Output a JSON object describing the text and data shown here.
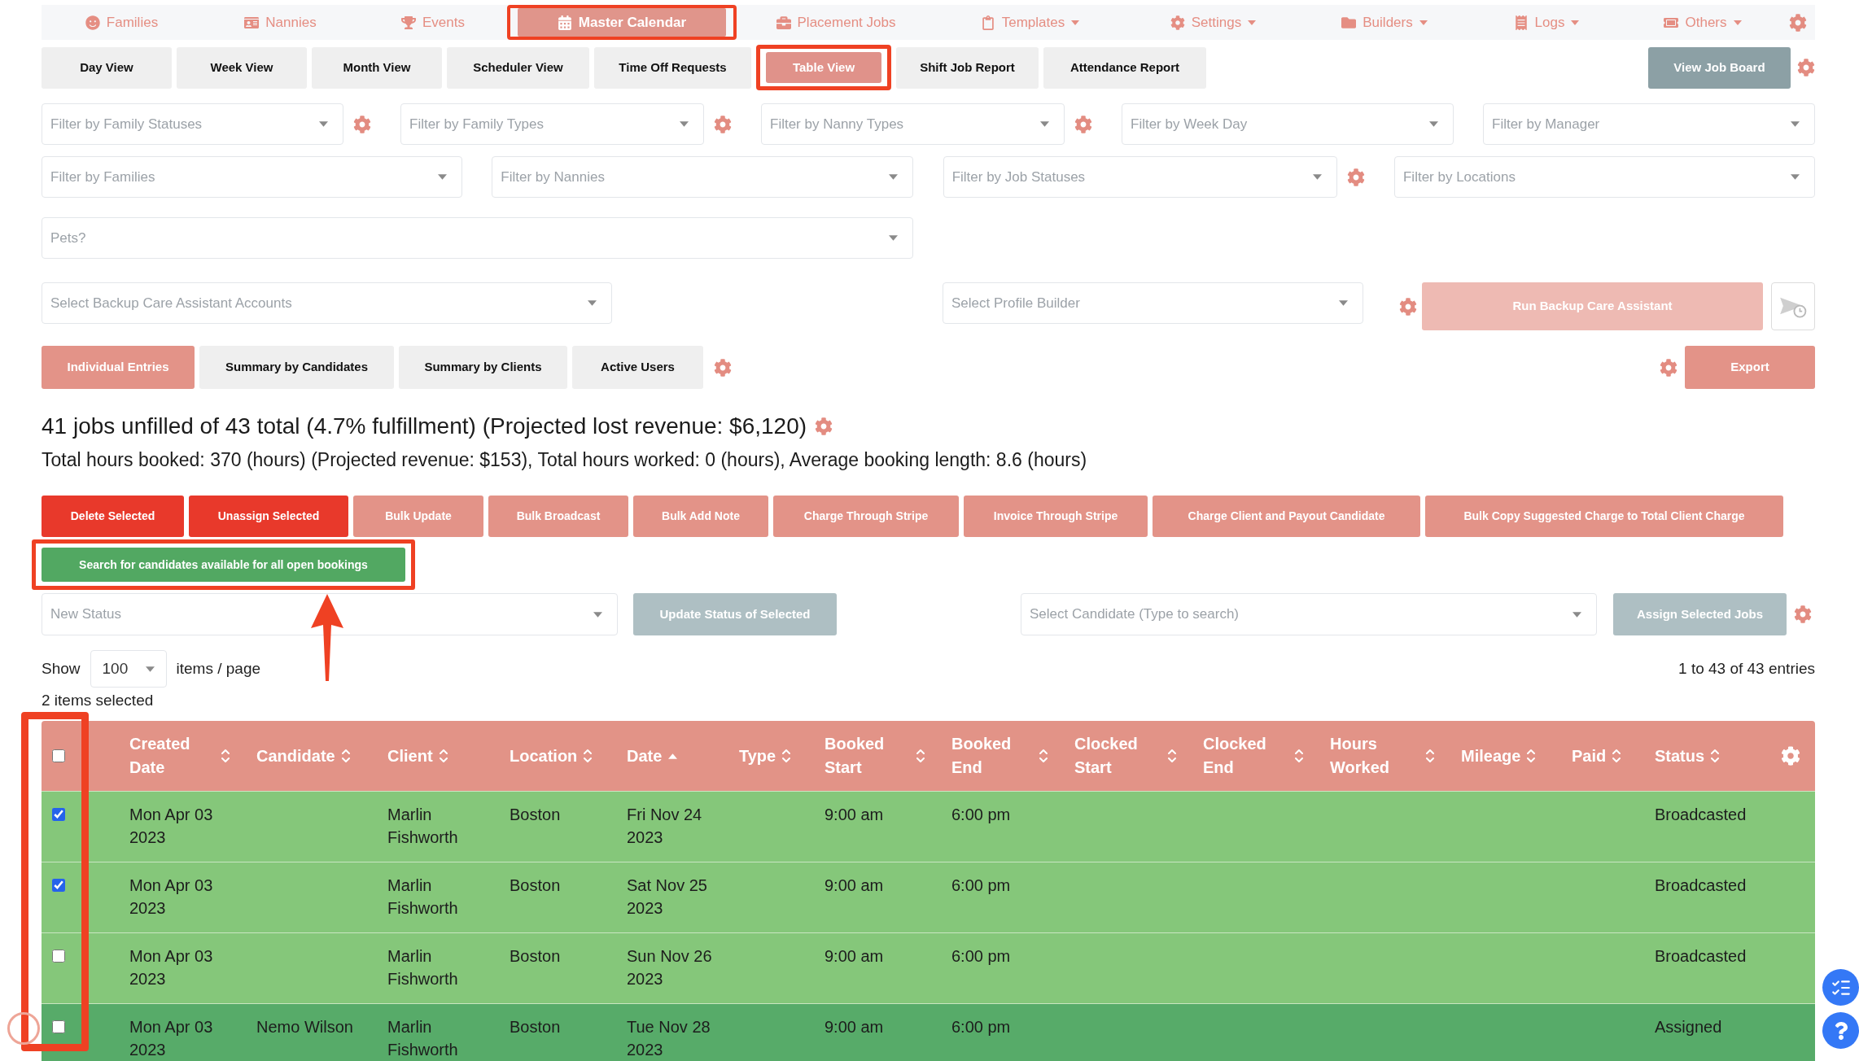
{
  "nav": [
    {
      "label": "Families",
      "selected": false,
      "has_menu": false,
      "highlighted": false
    },
    {
      "label": "Nannies",
      "selected": false,
      "has_menu": false,
      "highlighted": false
    },
    {
      "label": "Events",
      "selected": false,
      "has_menu": false,
      "highlighted": false
    },
    {
      "label": "Master Calendar",
      "selected": true,
      "has_menu": false,
      "highlighted": true
    },
    {
      "label": "Placement Jobs",
      "selected": false,
      "has_menu": false,
      "highlighted": false
    },
    {
      "label": "Templates",
      "selected": false,
      "has_menu": true,
      "highlighted": false
    },
    {
      "label": "Settings",
      "selected": false,
      "has_menu": true,
      "highlighted": false
    },
    {
      "label": "Builders",
      "selected": false,
      "has_menu": true,
      "highlighted": false
    },
    {
      "label": "Logs",
      "selected": false,
      "has_menu": true,
      "highlighted": false
    },
    {
      "label": "Others",
      "selected": false,
      "has_menu": true,
      "highlighted": false
    }
  ],
  "view_tabs": [
    {
      "label": "Day View",
      "selected": false,
      "highlighted": false
    },
    {
      "label": "Week View",
      "selected": false,
      "highlighted": false
    },
    {
      "label": "Month View",
      "selected": false,
      "highlighted": false
    },
    {
      "label": "Scheduler View",
      "selected": false,
      "highlighted": false
    },
    {
      "label": "Time Off Requests",
      "selected": false,
      "highlighted": false
    },
    {
      "label": "Table View",
      "selected": true,
      "highlighted": true
    },
    {
      "label": "Shift Job Report",
      "selected": false,
      "highlighted": false
    },
    {
      "label": "Attendance Report",
      "selected": false,
      "highlighted": false
    }
  ],
  "job_board_button": {
    "label": "View Job Board"
  },
  "filter_rows": [
    {
      "fields": [
        {
          "placeholder": "Filter by Family Statuses",
          "has_settings": true
        },
        {
          "placeholder": "Filter by Family Types",
          "has_settings": true
        },
        {
          "placeholder": "Filter by Nanny Types",
          "has_settings": true
        },
        {
          "placeholder": "Filter by Week Day",
          "has_settings": false
        },
        {
          "placeholder": "Filter by Manager",
          "has_settings": false
        }
      ]
    },
    {
      "fields": [
        {
          "placeholder": "Filter by Families",
          "has_settings": false
        },
        {
          "placeholder": "Filter by Nannies",
          "has_settings": false
        },
        {
          "placeholder": "Filter by Job Statuses",
          "has_settings": true
        },
        {
          "placeholder": "Filter by Locations",
          "has_settings": false
        }
      ]
    },
    {
      "fields": [
        {
          "placeholder": "Pets?",
          "has_settings": false
        }
      ]
    }
  ],
  "backup_care": {
    "accounts_placeholder": "Select Backup Care Assistant Accounts",
    "builder_placeholder": "Select Profile Builder",
    "run_button": {
      "label": "Run Backup Care Assistant",
      "disabled": true
    }
  },
  "report_tabs": [
    {
      "label": "Individual Entries",
      "selected": true
    },
    {
      "label": "Summary by Candidates",
      "selected": false
    },
    {
      "label": "Summary by Clients",
      "selected": false
    },
    {
      "label": "Active Users",
      "selected": false
    }
  ],
  "export_button": {
    "label": "Export"
  },
  "summary": {
    "headline": "41 jobs unfilled of 43 total (4.7% fulfillment) (Projected lost revenue: $6,120)",
    "totals": "Total hours booked: 370 (hours) (Projected revenue: $153), Total hours worked: 0 (hours), Average booking length: 8.6 (hours)"
  },
  "bulk_actions": [
    {
      "label": "Delete Selected",
      "kind": "danger"
    },
    {
      "label": "Unassign Selected",
      "kind": "danger"
    },
    {
      "label": "Bulk Update",
      "kind": "action"
    },
    {
      "label": "Bulk Broadcast",
      "kind": "action"
    },
    {
      "label": "Bulk Add Note",
      "kind": "action"
    },
    {
      "label": "Charge Through Stripe",
      "kind": "action"
    },
    {
      "label": "Invoice Through Stripe",
      "kind": "action"
    },
    {
      "label": "Charge Client and Payout Candidate",
      "kind": "action"
    },
    {
      "label": "Bulk Copy Suggested Charge to Total Client Charge",
      "kind": "action"
    }
  ],
  "search_button": {
    "label": "Search for candidates available for all open bookings",
    "highlighted": true
  },
  "status_update": {
    "placeholder": "New Status",
    "button": {
      "label": "Update Status of Selected",
      "disabled": true
    }
  },
  "assign": {
    "placeholder": "Select Candidate (Type to search)",
    "button": {
      "label": "Assign Selected Jobs",
      "disabled": true
    }
  },
  "pagination": {
    "show_label": "Show",
    "page_size": "100",
    "per_page_label": "items / page",
    "range": "1 to 43 of 43 entries"
  },
  "selection_note": "2 items selected",
  "table": {
    "select_all_checked": false,
    "checkbox_column_highlighted": true,
    "columns": [
      {
        "label": "Created Date",
        "sorted_ascending": false
      },
      {
        "label": "Candidate",
        "sorted_ascending": false
      },
      {
        "label": "Client",
        "sorted_ascending": false
      },
      {
        "label": "Location",
        "sorted_ascending": false
      },
      {
        "label": "Date",
        "sorted_ascending": true
      },
      {
        "label": "Type",
        "sorted_ascending": false
      },
      {
        "label": "Booked Start",
        "sorted_ascending": false
      },
      {
        "label": "Booked End",
        "sorted_ascending": false
      },
      {
        "label": "Clocked Start",
        "sorted_ascending": false
      },
      {
        "label": "Clocked End",
        "sorted_ascending": false
      },
      {
        "label": "Hours Worked",
        "sorted_ascending": false
      },
      {
        "label": "Mileage",
        "sorted_ascending": false
      },
      {
        "label": "Paid",
        "sorted_ascending": false
      },
      {
        "label": "Status",
        "sorted_ascending": false
      }
    ],
    "rows": [
      {
        "checked": true,
        "color": "#85c77a",
        "created_date": "Mon Apr 03 2023",
        "client": "Marlin Fishworth",
        "location": "Boston",
        "date": "Fri Nov 24 2023",
        "booked_start": "9:00 am",
        "booked_end": "6:00 pm",
        "status": "Broadcasted"
      },
      {
        "checked": true,
        "color": "#85c77a",
        "created_date": "Mon Apr 03 2023",
        "client": "Marlin Fishworth",
        "location": "Boston",
        "date": "Sat Nov 25 2023",
        "booked_start": "9:00 am",
        "booked_end": "6:00 pm",
        "status": "Broadcasted"
      },
      {
        "checked": false,
        "color": "#85c77a",
        "created_date": "Mon Apr 03 2023",
        "client": "Marlin Fishworth",
        "location": "Boston",
        "date": "Sun Nov 26 2023",
        "booked_start": "9:00 am",
        "booked_end": "6:00 pm",
        "status": "Broadcasted"
      },
      {
        "checked": false,
        "color": "#57ab69",
        "created_date": "Mon Apr 03 2023",
        "candidate": "Nemo Wilson",
        "client": "Marlin Fishworth",
        "location": "Boston",
        "date": "Tue Nov 28 2023",
        "booked_start": "9:00 am",
        "booked_end": "6:00 pm",
        "status": "Assigned"
      }
    ]
  }
}
